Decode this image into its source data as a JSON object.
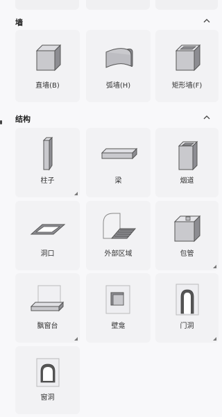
{
  "sections": [
    {
      "title": "墙",
      "items": [
        {
          "label": "直墙(B)",
          "icon": "straight-wall-icon",
          "has_submenu": false
        },
        {
          "label": "弧墙(H)",
          "icon": "arc-wall-icon",
          "has_submenu": false
        },
        {
          "label": "矩形墙(F)",
          "icon": "rect-wall-icon",
          "has_submenu": false
        }
      ]
    },
    {
      "title": "结构",
      "items": [
        {
          "label": "柱子",
          "icon": "column-icon",
          "has_submenu": true
        },
        {
          "label": "梁",
          "icon": "beam-icon",
          "has_submenu": false
        },
        {
          "label": "烟道",
          "icon": "flue-icon",
          "has_submenu": false
        },
        {
          "label": "洞口",
          "icon": "opening-icon",
          "has_submenu": false
        },
        {
          "label": "外部区域",
          "icon": "outer-area-icon",
          "has_submenu": false
        },
        {
          "label": "包管",
          "icon": "pipe-wrap-icon",
          "has_submenu": true
        },
        {
          "label": "飘窗台",
          "icon": "bay-window-icon",
          "has_submenu": true
        },
        {
          "label": "壁龛",
          "icon": "niche-icon",
          "has_submenu": false
        },
        {
          "label": "门洞",
          "icon": "door-opening-icon",
          "has_submenu": true
        },
        {
          "label": "窗洞",
          "icon": "window-opening-icon",
          "has_submenu": false
        }
      ]
    }
  ],
  "colors": {
    "tile_bg": "#f2f2f4",
    "page_bg": "#f8f8fa",
    "icon_face": "#c9c9cd",
    "icon_dark": "#8d8d92"
  }
}
